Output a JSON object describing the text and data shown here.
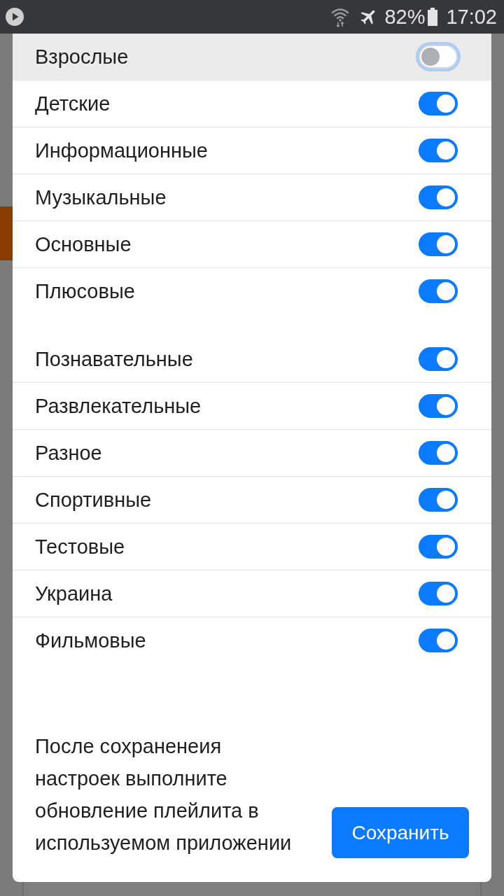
{
  "status_bar": {
    "battery": "82%",
    "time": "17:02"
  },
  "groups": [
    {
      "items": [
        {
          "label": "Взрослые",
          "on": false,
          "focused": true
        },
        {
          "label": "Детские",
          "on": true,
          "focused": false
        },
        {
          "label": "Информационные",
          "on": true,
          "focused": false
        },
        {
          "label": "Музыкальные",
          "on": true,
          "focused": false
        },
        {
          "label": "Основные",
          "on": true,
          "focused": false
        },
        {
          "label": "Плюсовые",
          "on": true,
          "focused": false
        }
      ]
    },
    {
      "items": [
        {
          "label": "Познавательные",
          "on": true,
          "focused": false
        },
        {
          "label": "Развлекательные",
          "on": true,
          "focused": false
        },
        {
          "label": "Разное",
          "on": true,
          "focused": false
        },
        {
          "label": "Спортивные",
          "on": true,
          "focused": false
        },
        {
          "label": "Тестовые",
          "on": true,
          "focused": false
        },
        {
          "label": "Украина",
          "on": true,
          "focused": false
        },
        {
          "label": "Фильмовые",
          "on": true,
          "focused": false
        }
      ]
    }
  ],
  "footer": {
    "note": "После сохраненеия настроек выполните обновление плейлита в используемом приложении",
    "save_button": "Сохранить"
  }
}
